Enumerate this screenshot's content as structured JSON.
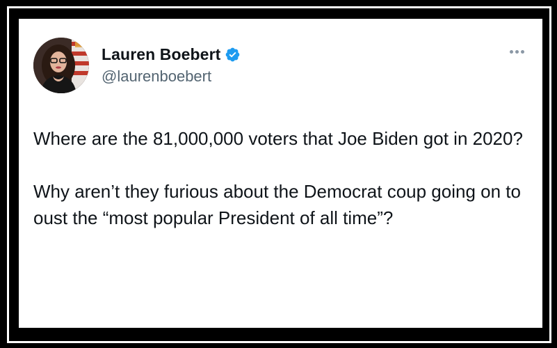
{
  "tweet": {
    "author": {
      "display_name": "Lauren Boebert",
      "handle": "@laurenboebert",
      "verified": true,
      "avatar_icon": "profile-photo"
    },
    "more_icon": "more-horizontal-icon",
    "paragraphs": [
      "Where are the 81,000,000 voters that Joe Biden got in 2020?",
      "Why aren’t they furious about the Democrat coup going on to oust the “most popular President of all time”?"
    ]
  },
  "colors": {
    "frame": "#000000",
    "card": "#ffffff",
    "text": "#0f1419",
    "secondary_text": "#536471",
    "verified_badge": "#1d9bf0"
  }
}
